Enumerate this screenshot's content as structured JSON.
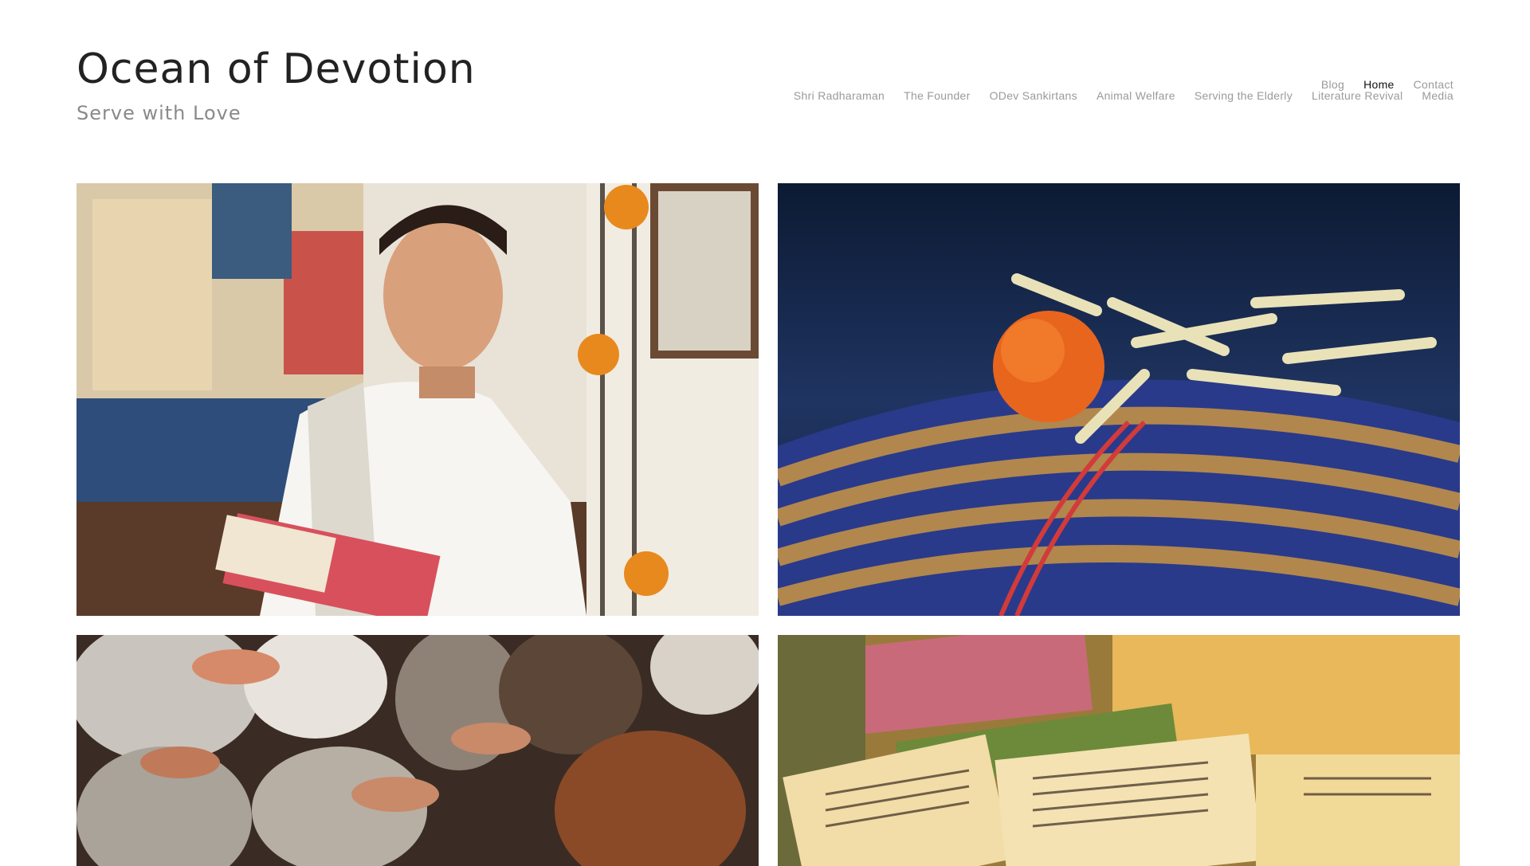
{
  "site": {
    "title": "Ocean of Devotion",
    "tagline": "Serve with Love"
  },
  "nav": {
    "row1": [
      {
        "label": "Blog",
        "active": false
      },
      {
        "label": "Home",
        "active": true
      },
      {
        "label": "Contact",
        "active": false
      }
    ],
    "row2": [
      {
        "label": "Shri Radharaman",
        "active": false
      },
      {
        "label": "The Founder",
        "active": false
      },
      {
        "label": "ODev Sankirtans",
        "active": false
      },
      {
        "label": "Animal Welfare",
        "active": false
      },
      {
        "label": "Serving the Elderly",
        "active": false
      },
      {
        "label": "Literature Revival",
        "active": false
      },
      {
        "label": "Media",
        "active": false
      }
    ]
  },
  "gallery": {
    "tiles": [
      {
        "subject": "founder-portrait"
      },
      {
        "subject": "manuscript-with-flowers"
      },
      {
        "subject": "calves-herd"
      },
      {
        "subject": "old-manuscripts"
      }
    ]
  },
  "colors": {
    "title": "#222222",
    "tagline": "#8a8a8a",
    "nav": "#9a9a9a",
    "nav_active": "#111111"
  }
}
